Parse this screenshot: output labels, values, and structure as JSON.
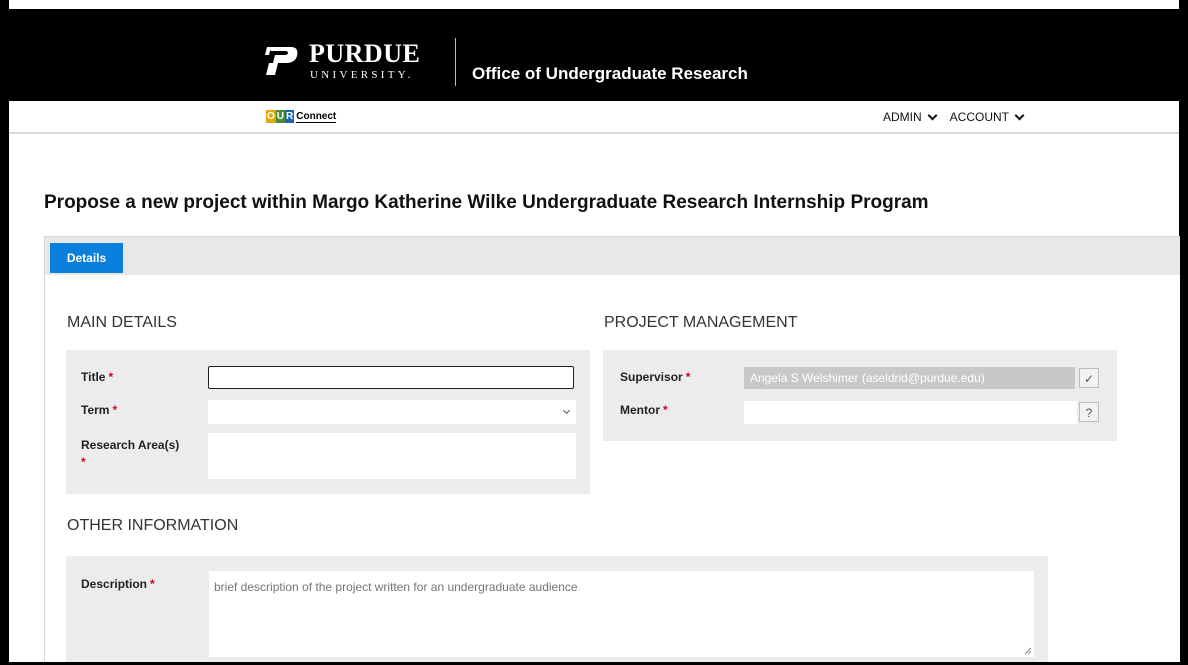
{
  "header": {
    "university_name": "PURDUE",
    "university_sub": "UNIVERSITY.",
    "office_title": "Office of Undergraduate Research"
  },
  "nav": {
    "logo": {
      "o": "O",
      "u": "U",
      "r": "R",
      "connect": "Connect"
    },
    "menu": [
      {
        "label": "ADMIN"
      },
      {
        "label": "ACCOUNT"
      }
    ]
  },
  "page": {
    "title": "Propose a new project within Margo Katherine Wilke Undergraduate Research Internship Program"
  },
  "tabs": [
    {
      "label": "Details",
      "active": true
    }
  ],
  "main_details": {
    "heading": "MAIN DETAILS",
    "title_label": "Title",
    "title_value": "",
    "term_label": "Term",
    "term_value": "",
    "research_area_label": "Research Area(s)",
    "research_area_value": ""
  },
  "project_management": {
    "heading": "PROJECT MANAGEMENT",
    "supervisor_label": "Supervisor",
    "supervisor_value": "Angela S Welshimer (aseldrid@purdue.edu)",
    "supervisor_button": "✓",
    "mentor_label": "Mentor",
    "mentor_value": "",
    "mentor_button": "?"
  },
  "other_information": {
    "heading": "OTHER INFORMATION",
    "description_label": "Description",
    "description_placeholder": "brief description of the project written for an undergraduate audience"
  },
  "required_marker": "*",
  "colors": {
    "header_bg": "#000000",
    "tab_active": "#0a7fdc",
    "required": "#d0021b",
    "panel_bg": "#ececec"
  }
}
